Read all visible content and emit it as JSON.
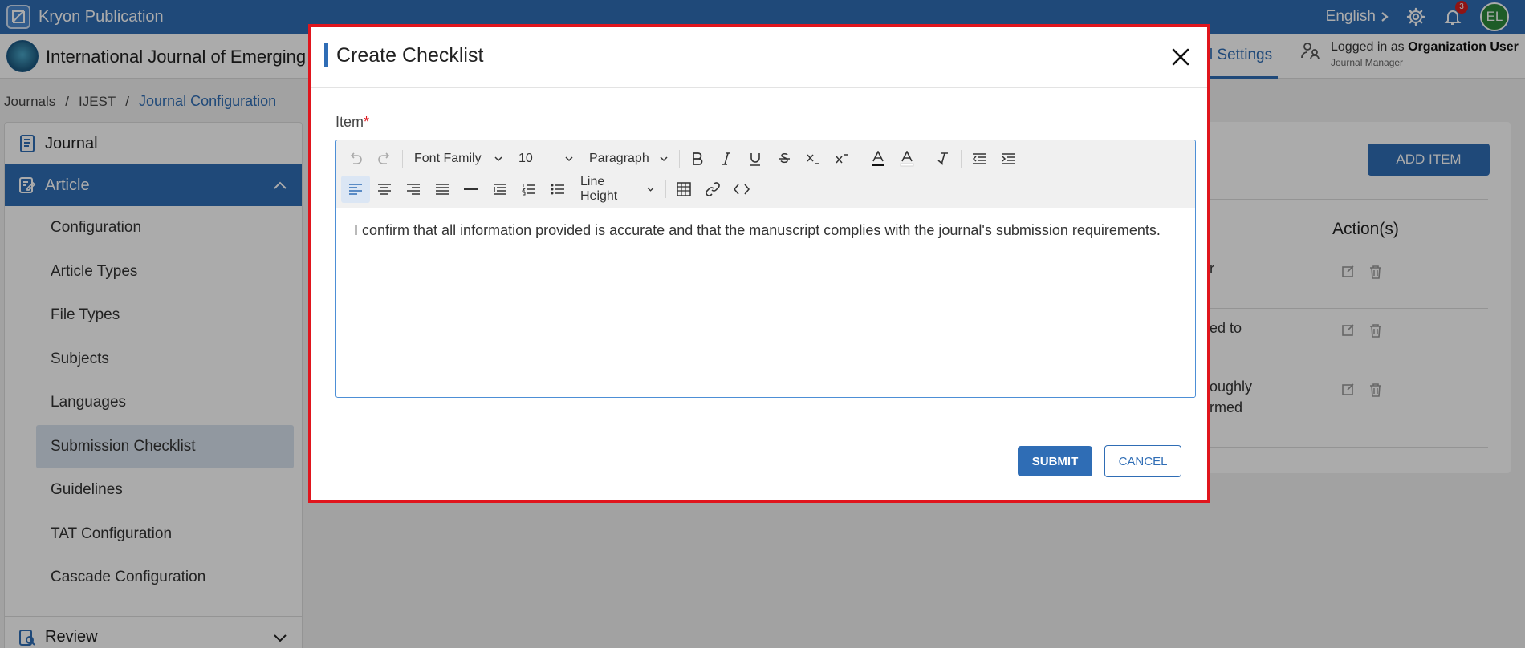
{
  "app": {
    "title": "Kryon Publication",
    "language": "English",
    "notification_count": "3",
    "user_initials": "EL"
  },
  "journal": {
    "name": "International Journal of Emerging"
  },
  "header": {
    "settings_tab": "l Settings",
    "logged_prefix": "Logged in as",
    "logged_user": "Organization User",
    "logged_role": "Journal Manager"
  },
  "breadcrumb": {
    "items": [
      "Journals",
      "IJEST",
      "Journal Configuration"
    ]
  },
  "sidebar": {
    "journal": "Journal",
    "article": "Article",
    "items": [
      "Configuration",
      "Article Types",
      "File Types",
      "Subjects",
      "Languages",
      "Submission Checklist",
      "Guidelines",
      "TAT Configuration",
      "Cascade Configuration"
    ],
    "review": "Review"
  },
  "main": {
    "add_item": "ADD ITEM",
    "actions_header": "Action(s)",
    "row_fragments": [
      {
        "line1": "r",
        "line2": ""
      },
      {
        "line1": "ed to",
        "line2": ""
      },
      {
        "line1": "oughly",
        "line2": "rmed"
      }
    ]
  },
  "modal": {
    "title": "Create Checklist",
    "field_label": "Item",
    "required_mark": "*",
    "toolbar": {
      "font_family": "Font Family",
      "font_size": "10",
      "block_format": "Paragraph",
      "line_height": "Line Height"
    },
    "content": "I confirm that all information provided is accurate and that the manuscript complies with the journal's submission requirements.",
    "submit": "SUBMIT",
    "cancel": "CANCEL"
  }
}
